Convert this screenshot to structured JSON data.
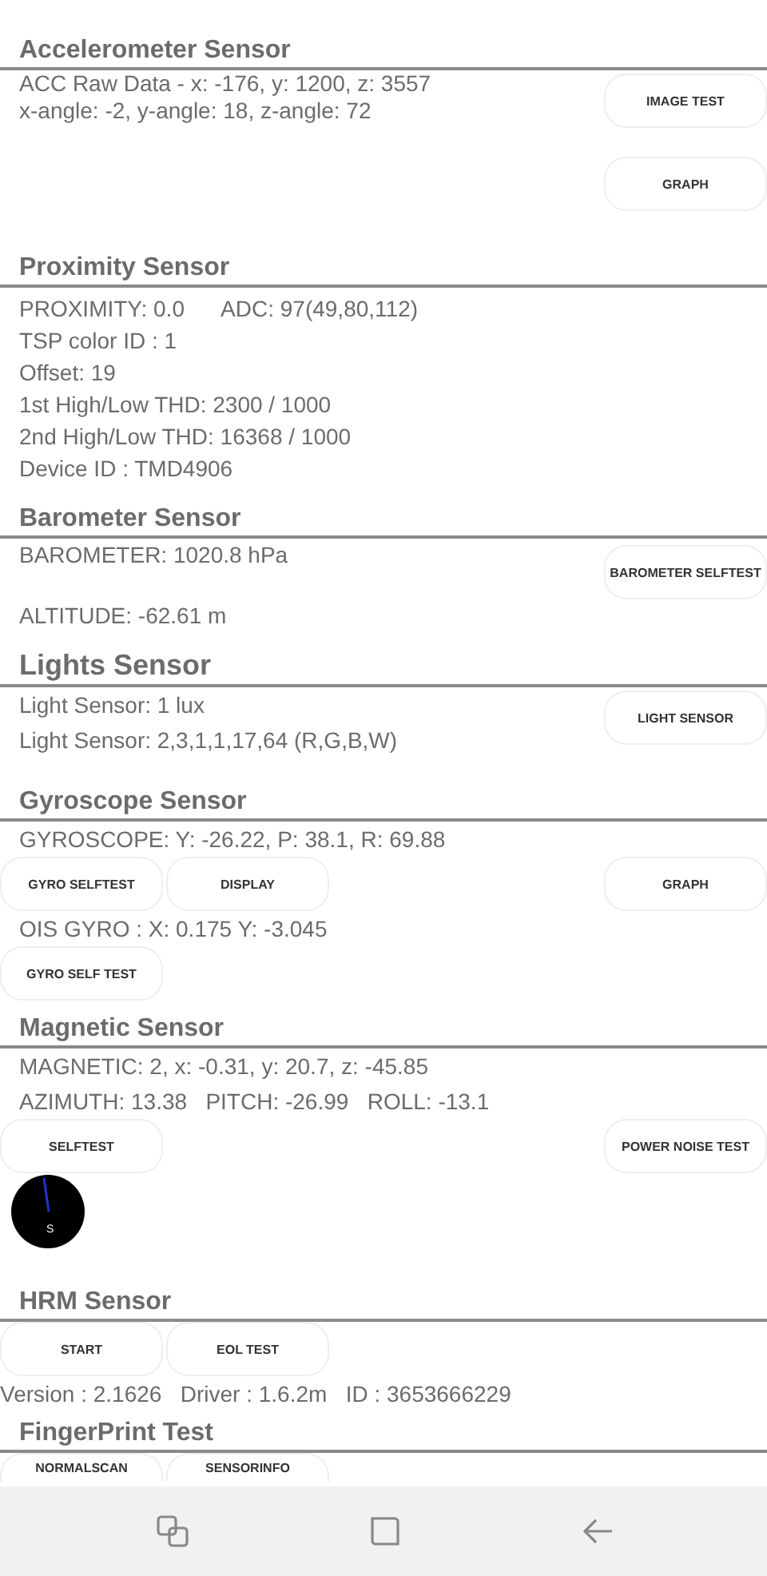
{
  "sections": [
    {
      "title": "Accelerometer Sensor",
      "large": false,
      "lines": [
        "ACC Raw Data - x: -176, y: 1200, z: 3557",
        "x-angle: -2, y-angle: 18, z-angle: 72"
      ],
      "side_buttons": [
        "IMAGE TEST",
        "GRAPH"
      ],
      "kind": "side"
    },
    {
      "title": "Proximity Sensor",
      "large": false,
      "lines": [
        "PROXIMITY: 0.0      ADC: 97(49,80,112)",
        "TSP color ID : 1",
        "Offset: 19",
        "1st High/Low THD: 2300 / 1000",
        "2nd High/Low THD: 16368 / 1000",
        "Device ID : TMD4906"
      ],
      "kind": "plain"
    },
    {
      "title": "Barometer Sensor",
      "large": false,
      "lines": [
        "BAROMETER: 1020.8 hPa",
        "ALTITUDE: -62.61 m"
      ],
      "side_buttons": [
        "BAROMETER SELFTEST"
      ],
      "kind": "spread"
    },
    {
      "title": "Lights Sensor",
      "large": true,
      "lines": [
        "Light Sensor: 1 lux",
        "Light Sensor: 2,3,1,1,17,64 (R,G,B,W)"
      ],
      "side_buttons": [
        "LIGHT SENSOR"
      ],
      "kind": "side"
    },
    {
      "title": "Gyroscope Sensor",
      "large": false,
      "kind": "rows",
      "rows": [
        {
          "kind": "text",
          "text": "GYROSCOPE: Y: -26.22, P: 38.1, R: 69.88"
        },
        {
          "kind": "buttons",
          "left": [
            "GYRO SELFTEST",
            "DISPLAY"
          ],
          "right": [
            "GRAPH"
          ]
        },
        {
          "kind": "text",
          "text": "OIS GYRO : X: 0.175 Y: -3.045"
        },
        {
          "kind": "buttons",
          "left": [
            "GYRO SELF TEST"
          ],
          "right": []
        }
      ]
    },
    {
      "title": "Magnetic Sensor",
      "large": false,
      "kind": "rows",
      "rows": [
        {
          "kind": "text",
          "text": "MAGNETIC: 2, x: -0.31, y: 20.7, z: -45.85"
        },
        {
          "kind": "text",
          "text": "AZIMUTH: 13.38   PITCH: -26.99   ROLL: -13.1"
        },
        {
          "kind": "buttons",
          "left": [
            "SELFTEST"
          ],
          "right": [
            "POWER NOISE TEST"
          ]
        },
        {
          "kind": "compass",
          "label": "S"
        }
      ]
    },
    {
      "title": "HRM Sensor",
      "large": false,
      "kind": "rows",
      "rows": [
        {
          "kind": "buttons",
          "left": [
            "START",
            "EOL TEST"
          ],
          "right": []
        },
        {
          "kind": "flush",
          "text": "Version : 2.1626   Driver : 1.6.2m   ID : 3653666229"
        }
      ]
    },
    {
      "title": "FingerPrint Test",
      "large": false,
      "kind": "rows",
      "rows": [
        {
          "kind": "buttons",
          "left": [
            "NORMALSCAN",
            "SENSORINFO"
          ],
          "right": []
        }
      ]
    }
  ]
}
